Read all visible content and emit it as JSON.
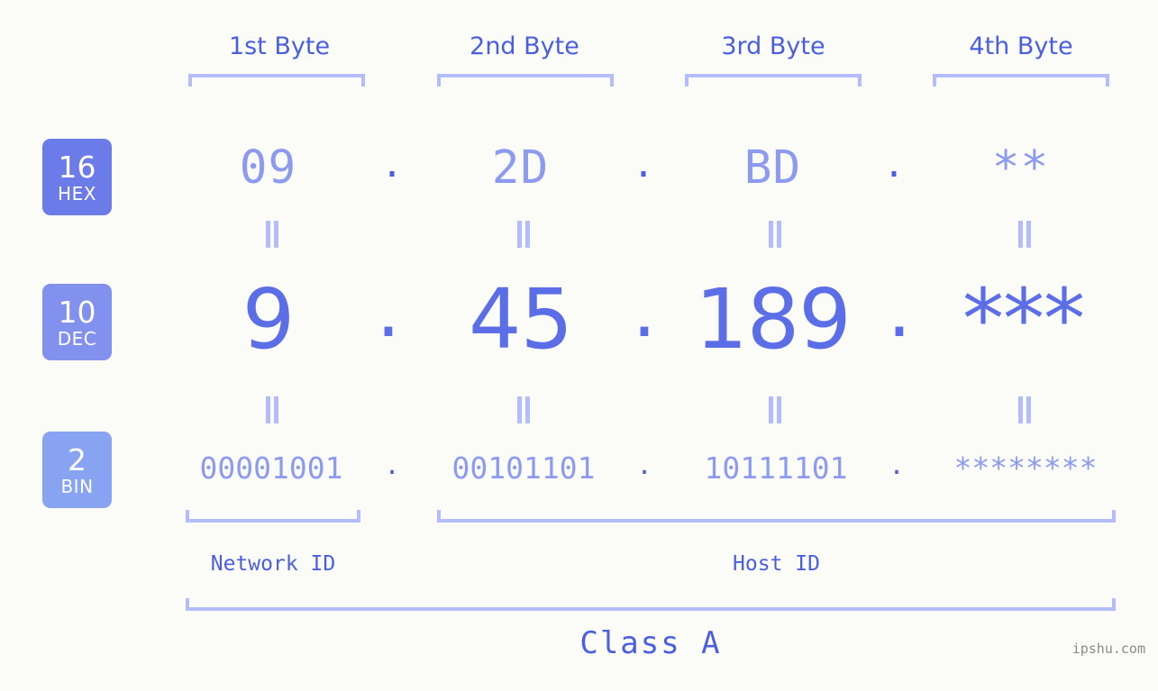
{
  "meta": {
    "background_color": "#fbfcf8",
    "accent_color": "#5b6ee8",
    "bracket_color": "#b4bdfb",
    "watermark": "ipshu.com"
  },
  "byte_headers": [
    {
      "label": "1st Byte"
    },
    {
      "label": "2nd Byte"
    },
    {
      "label": "3rd Byte"
    },
    {
      "label": "4th Byte"
    }
  ],
  "rows": [
    {
      "key": "hex",
      "badge": {
        "base": "16",
        "name": "HEX",
        "color": "#6b7be8"
      },
      "values": [
        "09",
        "2D",
        "BD",
        "**"
      ],
      "separator": "."
    },
    {
      "key": "dec",
      "badge": {
        "base": "10",
        "name": "DEC",
        "color": "#8290ee"
      },
      "values": [
        "9",
        "45",
        "189",
        "***"
      ],
      "separator": "."
    },
    {
      "key": "bin",
      "badge": {
        "base": "2",
        "name": "BIN",
        "color": "#87a3f2"
      },
      "values": [
        "00001001",
        "00101101",
        "10111101",
        "********"
      ],
      "separator": "."
    }
  ],
  "equals_marks": {
    "glyph": "=",
    "rows": [
      "hex-to-dec",
      "dec-to-bin"
    ]
  },
  "regions": [
    {
      "label": "Network ID",
      "bytes": [
        1
      ]
    },
    {
      "label": "Host ID",
      "bytes": [
        2,
        3,
        4
      ]
    }
  ],
  "class": {
    "label": "Class A"
  }
}
